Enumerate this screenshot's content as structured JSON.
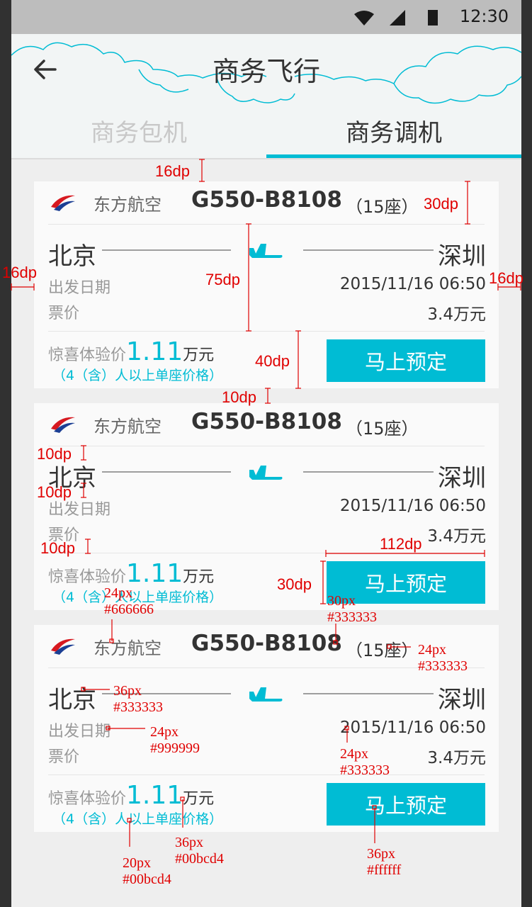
{
  "status_bar": {
    "time": "12:30"
  },
  "header": {
    "title": "商务飞行",
    "back_icon": "arrow-left-icon"
  },
  "tabs": [
    {
      "label": "商务包机",
      "active": false
    },
    {
      "label": "商务调机",
      "active": true
    }
  ],
  "colors": {
    "accent": "#00bcd4",
    "text_primary": "#333333",
    "text_secondary": "#666666",
    "text_hint": "#999999",
    "status_bar": "#bdbdbd"
  },
  "cards": [
    {
      "airline": "东方航空",
      "aircraft": "G550-B8108",
      "seats": "（15座）",
      "from": "北京",
      "to": "深圳",
      "date_label": "出发日期",
      "date_value": "2015/11/16  06:50",
      "price_label": "票价",
      "price_value": "3.4万元",
      "promo_label": "惊喜体验价",
      "promo_value": "1.11",
      "promo_unit": "万元",
      "promo_note": "（4（含）人以上单座价格）",
      "book_label": "马上预定"
    },
    {
      "airline": "东方航空",
      "aircraft": "G550-B8108",
      "seats": "（15座）",
      "from": "北京",
      "to": "深圳",
      "date_label": "出发日期",
      "date_value": "2015/11/16  06:50",
      "price_label": "票价",
      "price_value": "3.4万元",
      "promo_label": "惊喜体验价",
      "promo_value": "1.11",
      "promo_unit": "万元",
      "promo_note": "（4（含）人以上单座价格）",
      "book_label": "马上预定"
    },
    {
      "airline": "东方航空",
      "aircraft": "G550-B8108",
      "seats": "（15座）",
      "from": "北京",
      "to": "深圳",
      "date_label": "出发日期",
      "date_value": "2015/11/16  06:50",
      "price_label": "票价",
      "price_value": "3.4万元",
      "promo_label": "惊喜体验价",
      "promo_value": "1.11",
      "promo_unit": "万元",
      "promo_note": "（4（含）人以上单座价格）",
      "book_label": "马上预定"
    }
  ],
  "annotations": {
    "dp": [
      "16dp",
      "30dp",
      "16dp",
      "75dp",
      "16dp",
      "40dp",
      "10dp",
      "10dp",
      "10dp",
      "10dp",
      "112dp",
      "30dp"
    ],
    "px": [
      "24px\n#666666",
      "30px\n#333333",
      "24px\n#333333",
      "36px\n#333333",
      "24px\n#999999",
      "24px\n#333333",
      "36px\n#00bcd4",
      "20px\n#00bcd4",
      "36px\n#ffffff"
    ]
  }
}
